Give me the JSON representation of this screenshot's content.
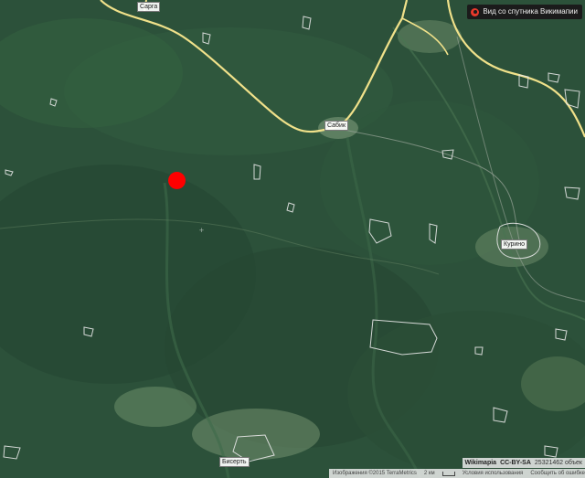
{
  "layer_button": {
    "label": "Вид со спутника Викимапии",
    "icon": "wikimapia-logo-icon"
  },
  "towns": [
    {
      "id": "sarga",
      "label": "Сарга"
    },
    {
      "id": "sabik",
      "label": "Сабик"
    },
    {
      "id": "kurino",
      "label": "Курино"
    },
    {
      "id": "biserst",
      "label": "Бисерть"
    }
  ],
  "marker": {
    "color": "#ff0000",
    "icon": "location-dot-icon"
  },
  "attribution": {
    "brand": "Wikimapia",
    "license": "CC-BY-SA",
    "objects": "25321462 объек"
  },
  "footer": {
    "imagery": "Изображения ©2015 TerraMetrics",
    "scale": "2 км",
    "terms": "Условия использования",
    "report": "Сообщить об ошибке"
  },
  "colors": {
    "forest": "#2d5a3a",
    "road": "#f0e18a",
    "outline": "#e8e8e8",
    "marker": "#ff0000"
  }
}
